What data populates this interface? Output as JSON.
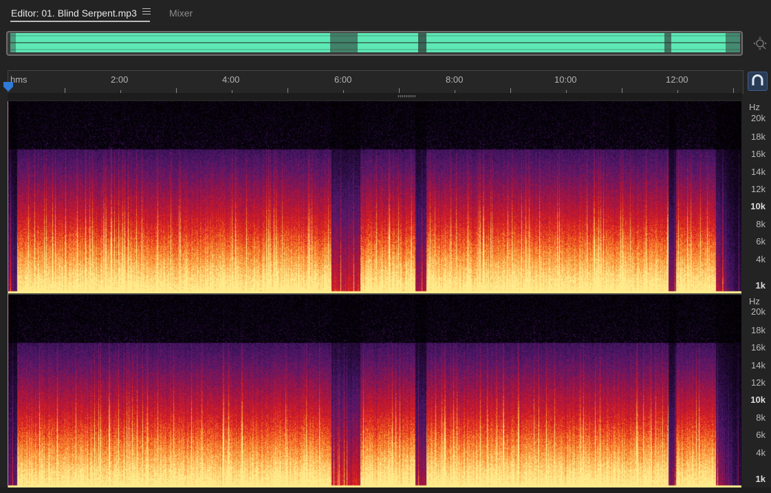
{
  "tabs": {
    "editor_label": "Editor: 01. Blind Serpent.mp3",
    "mixer_label": "Mixer"
  },
  "icons": {
    "panel_menu": "hamburger-menu-icon",
    "zoom": "zoom-navigator-icon",
    "playhead": "playhead-marker-icon",
    "snap": "snapping-magnet-icon"
  },
  "ruler": {
    "unit_label": "hms",
    "labels": [
      "2:00",
      "4:00",
      "6:00",
      "8:00",
      "10:00",
      "12:00"
    ]
  },
  "channels": [
    {
      "axis_unit": "Hz",
      "axis_labels": [
        "20k",
        "18k",
        "16k",
        "14k",
        "12k",
        "10k",
        "8k",
        "6k",
        "4k",
        "1k"
      ]
    },
    {
      "axis_unit": "Hz",
      "axis_labels": [
        "20k",
        "18k",
        "16k",
        "14k",
        "12k",
        "10k",
        "8k",
        "6k",
        "4k",
        "1k"
      ]
    }
  ],
  "colors": {
    "waveform": "#5de8b5",
    "spectral_low": "#2a0f3c",
    "spectral_mid": "#d4142c",
    "spectral_high": "#ffe27a",
    "snap_active": "#2a5fa8"
  }
}
